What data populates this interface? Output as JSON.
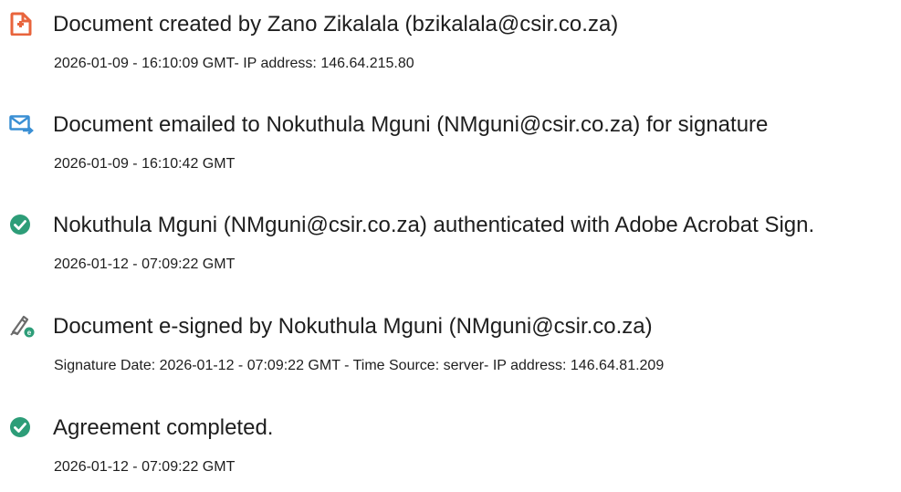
{
  "audit_events": [
    {
      "icon": "document-created-icon",
      "title": "Document created by Zano Zikalala (bzikalala@csir.co.za)",
      "detail": "2026-01-09 - 16:10:09 GMT- IP address: 146.64.215.80"
    },
    {
      "icon": "email-sent-icon",
      "title": "Document emailed to Nokuthula Mguni (NMguni@csir.co.za) for signature",
      "detail": "2026-01-09 - 16:10:42 GMT"
    },
    {
      "icon": "check-circle-icon",
      "title": "Nokuthula Mguni (NMguni@csir.co.za) authenticated with Adobe Acrobat Sign.",
      "detail": "2026-01-12 - 07:09:22 GMT"
    },
    {
      "icon": "e-sign-pen-icon",
      "title": "Document e-signed by Nokuthula Mguni (NMguni@csir.co.za)",
      "detail": "Signature Date: 2026-01-12 - 07:09:22 GMT - Time Source: server- IP address: 146.64.81.209"
    },
    {
      "icon": "check-circle-icon",
      "title": "Agreement completed.",
      "detail": "2026-01-12 - 07:09:22 GMT"
    }
  ],
  "colors": {
    "document_icon": "#e8643c",
    "email_icon": "#3a8fd4",
    "check_icon": "#2d9d78",
    "pen_icon": "#6b6b6b",
    "e_badge": "#2d9d78",
    "text": "#1e1e1e"
  }
}
